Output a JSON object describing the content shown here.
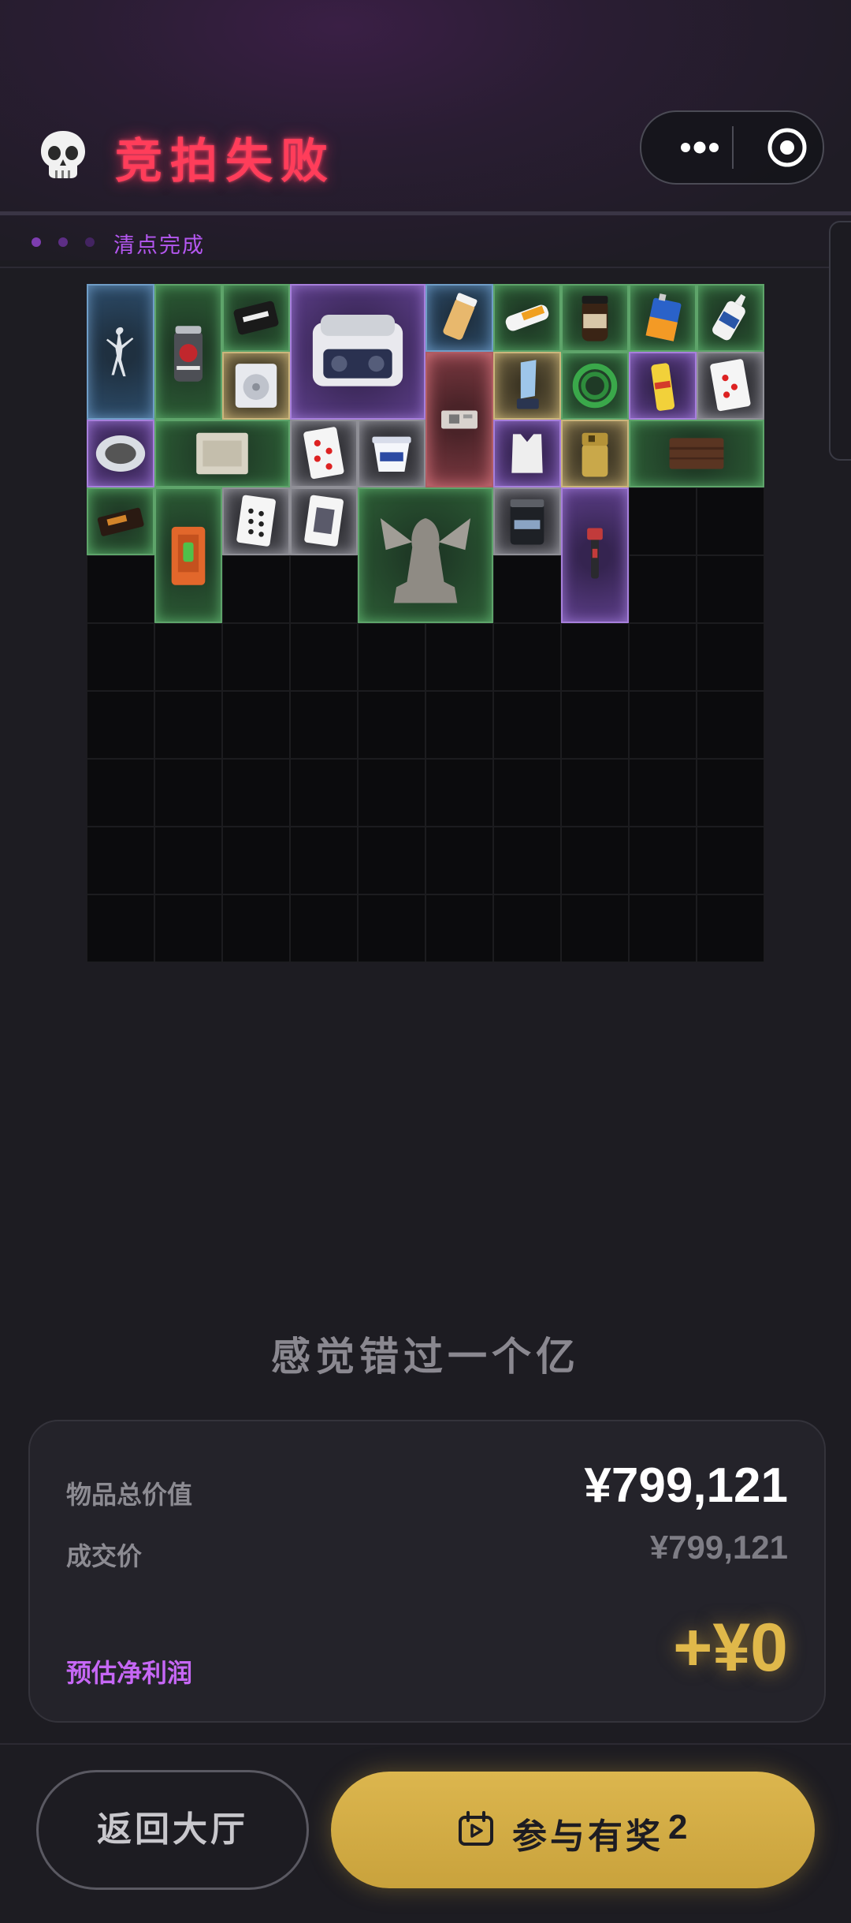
{
  "header": {
    "title": "竞拍失败",
    "icon": "skull-icon"
  },
  "capsule": {
    "more_icon": "more-dots-icon",
    "close_icon": "target-close-icon"
  },
  "status": {
    "text": "清点完成"
  },
  "grid": {
    "cols": 10,
    "rows": 10,
    "items": [
      {
        "name": "ballerina-figurine",
        "quality": "blue",
        "col": 0,
        "row": 0,
        "w": 1,
        "h": 2
      },
      {
        "name": "energy-drink-can",
        "quality": "green",
        "col": 1,
        "row": 0,
        "w": 1,
        "h": 2
      },
      {
        "name": "good-luck-card",
        "quality": "green",
        "col": 2,
        "row": 0,
        "w": 1,
        "h": 1
      },
      {
        "name": "lab-machine",
        "quality": "purple",
        "col": 3,
        "row": 0,
        "w": 2,
        "h": 2
      },
      {
        "name": "pill-bottle",
        "quality": "blue",
        "col": 5,
        "row": 0,
        "w": 1,
        "h": 1
      },
      {
        "name": "power-bank",
        "quality": "green",
        "col": 6,
        "row": 0,
        "w": 1,
        "h": 1
      },
      {
        "name": "coffee-jar",
        "quality": "green",
        "col": 7,
        "row": 0,
        "w": 1,
        "h": 1
      },
      {
        "name": "battery-9v",
        "quality": "green",
        "col": 8,
        "row": 0,
        "w": 1,
        "h": 1
      },
      {
        "name": "glue-bottle",
        "quality": "green",
        "col": 9,
        "row": 0,
        "w": 1,
        "h": 1
      },
      {
        "name": "cd-drive",
        "quality": "gold",
        "col": 2,
        "row": 1,
        "w": 1,
        "h": 1
      },
      {
        "name": "circuit-module",
        "quality": "red",
        "col": 5,
        "row": 1,
        "w": 1,
        "h": 2
      },
      {
        "name": "crystal-trophy",
        "quality": "gold",
        "col": 6,
        "row": 1,
        "w": 1,
        "h": 1
      },
      {
        "name": "green-cable",
        "quality": "green",
        "col": 7,
        "row": 1,
        "w": 1,
        "h": 1
      },
      {
        "name": "yellow-can",
        "quality": "purple",
        "col": 8,
        "row": 1,
        "w": 1,
        "h": 1
      },
      {
        "name": "playing-card-hearts",
        "quality": "gray",
        "col": 9,
        "row": 1,
        "w": 1,
        "h": 1
      },
      {
        "name": "oval-plate",
        "quality": "purple",
        "col": 0,
        "row": 2,
        "w": 1,
        "h": 1
      },
      {
        "name": "old-paper",
        "quality": "green",
        "col": 1,
        "row": 2,
        "w": 2,
        "h": 1
      },
      {
        "name": "playing-card-hearts-2",
        "quality": "gray",
        "col": 3,
        "row": 2,
        "w": 1,
        "h": 1
      },
      {
        "name": "yogurt-cup",
        "quality": "gray",
        "col": 4,
        "row": 2,
        "w": 1,
        "h": 1
      },
      {
        "name": "vest",
        "quality": "purple",
        "col": 6,
        "row": 2,
        "w": 1,
        "h": 1
      },
      {
        "name": "lighter",
        "quality": "gold",
        "col": 7,
        "row": 2,
        "w": 1,
        "h": 1
      },
      {
        "name": "wooden-plank",
        "quality": "green",
        "col": 8,
        "row": 2,
        "w": 2,
        "h": 1
      },
      {
        "name": "chocolate-bar",
        "quality": "green",
        "col": 0,
        "row": 3,
        "w": 1,
        "h": 1
      },
      {
        "name": "orange-device",
        "quality": "green",
        "col": 1,
        "row": 3,
        "w": 1,
        "h": 2
      },
      {
        "name": "playing-card-spades",
        "quality": "gray",
        "col": 2,
        "row": 3,
        "w": 1,
        "h": 1
      },
      {
        "name": "playing-card-face",
        "quality": "gray",
        "col": 3,
        "row": 3,
        "w": 1,
        "h": 1
      },
      {
        "name": "sphinx-statue",
        "quality": "green",
        "col": 4,
        "row": 3,
        "w": 2,
        "h": 2
      },
      {
        "name": "protein-tub",
        "quality": "gray",
        "col": 6,
        "row": 3,
        "w": 1,
        "h": 1
      },
      {
        "name": "pipe-wrench",
        "quality": "purple",
        "col": 7,
        "row": 3,
        "w": 1,
        "h": 2
      }
    ]
  },
  "subtitle": "感觉错过一个亿",
  "summary": {
    "total_label": "物品总价值",
    "total_value": "¥799,121",
    "deal_label": "成交价",
    "deal_value": "¥799,121",
    "profit_label": "预估净利润",
    "profit_value": "+¥0"
  },
  "buttons": {
    "back_label": "返回大厅",
    "join_label": "参与有奖",
    "join_count": "2",
    "join_icon": "play-calendar-icon"
  },
  "colors": {
    "title": "#ff3d5a",
    "status": "#b457f0",
    "profit_label": "#c667f5",
    "profit_value": "#e0b84a",
    "join_button": "#d4ae48"
  }
}
